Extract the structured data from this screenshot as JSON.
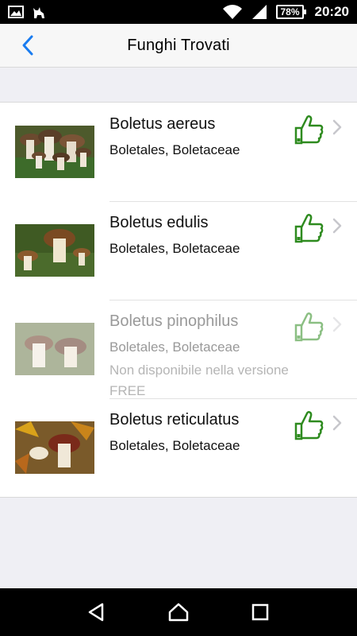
{
  "status_bar": {
    "battery": "78%",
    "time": "20:20",
    "icons": [
      "image-icon",
      "cat-icon",
      "wifi-icon",
      "signal-icon",
      "battery-icon"
    ]
  },
  "nav": {
    "title": "Funghi Trovati",
    "back_icon": "chevron-left-icon"
  },
  "items": [
    {
      "name": "Boletus aereus",
      "family": "Boletales, Boletaceae",
      "note": "",
      "available": true
    },
    {
      "name": "Boletus edulis",
      "family": "Boletales, Boletaceae",
      "note": "",
      "available": true
    },
    {
      "name": "Boletus pinophilus",
      "family": "Boletales, Boletaceae",
      "note": "Non disponibile nella versione FREE",
      "available": false
    },
    {
      "name": "Boletus reticulatus",
      "family": "Boletales, Boletaceae",
      "note": "",
      "available": true
    }
  ],
  "colors": {
    "accent": "#1a7cf0",
    "thumb_green": "#2e8b1f",
    "chevron": "#c7c7cc",
    "disabled_text": "#b5b5b5"
  },
  "android_nav": [
    "back-triangle-icon",
    "home-icon",
    "recents-icon"
  ]
}
